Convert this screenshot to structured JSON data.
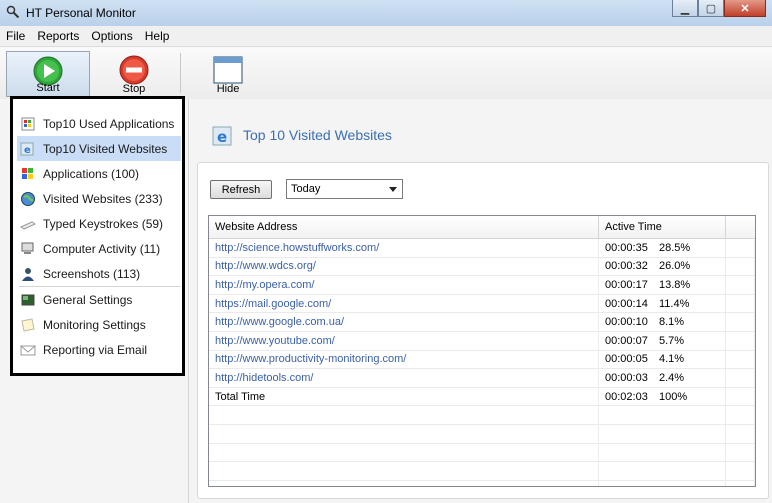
{
  "window": {
    "title": "HT Personal Monitor"
  },
  "menu": [
    "File",
    "Reports",
    "Options",
    "Help"
  ],
  "toolbar": {
    "start": "Start",
    "stop": "Stop",
    "hide": "Hide"
  },
  "sidebar": {
    "items": [
      {
        "label": "Top10 Used Applications",
        "icon": "apps-icon"
      },
      {
        "label": "Top10 Visited Websites",
        "icon": "ie-icon",
        "selected": true
      },
      {
        "label": "Applications (100)",
        "icon": "windows-icon"
      },
      {
        "label": "Visited Websites (233)",
        "icon": "globe-icon"
      },
      {
        "label": "Typed Keystrokes (59)",
        "icon": "keyboard-icon"
      },
      {
        "label": "Computer Activity (11)",
        "icon": "computer-icon"
      },
      {
        "label": "Screenshots (113)",
        "icon": "user-icon"
      },
      {
        "label": "General Settings",
        "icon": "settings-icon"
      },
      {
        "label": "Monitoring Settings",
        "icon": "note-icon"
      },
      {
        "label": "Reporting via Email",
        "icon": "email-icon"
      }
    ]
  },
  "main": {
    "title": "Top 10 Visited Websites",
    "refresh_label": "Refresh",
    "period": "Today",
    "table": {
      "headers": [
        "Website Address",
        "Active Time"
      ],
      "rows": [
        {
          "url": "http://science.howstuffworks.com/",
          "time": "00:00:35",
          "pct": "28.5%"
        },
        {
          "url": "http://www.wdcs.org/",
          "time": "00:00:32",
          "pct": "26.0%"
        },
        {
          "url": "http://my.opera.com/",
          "time": "00:00:17",
          "pct": "13.8%"
        },
        {
          "url": "https://mail.google.com/",
          "time": "00:00:14",
          "pct": "11.4%"
        },
        {
          "url": "http://www.google.com.ua/",
          "time": "00:00:10",
          "pct": "8.1%"
        },
        {
          "url": "http://www.youtube.com/",
          "time": "00:00:07",
          "pct": "5.7%"
        },
        {
          "url": "http://www.productivity-monitoring.com/",
          "time": "00:00:05",
          "pct": "4.1%"
        },
        {
          "url": "http://hidetools.com/",
          "time": "00:00:03",
          "pct": "2.4%"
        }
      ],
      "total": {
        "label": "Total Time",
        "time": "00:02:03",
        "pct": "100%"
      }
    }
  },
  "colors": {
    "accent": "#3a6fb3",
    "selection": "#c9ddf6",
    "link": "#3a5fa8"
  }
}
